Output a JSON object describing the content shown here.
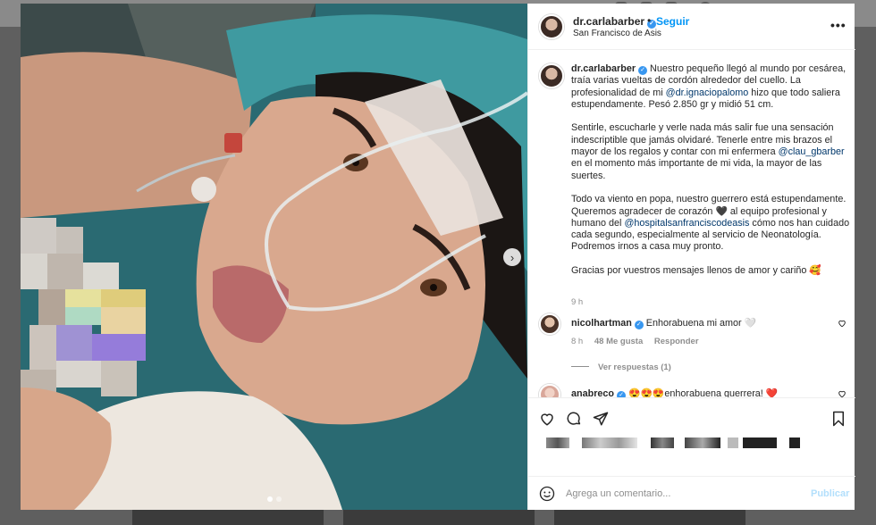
{
  "post": {
    "username": "dr.carlabarber",
    "follow_label": "Seguir",
    "separator": "•",
    "location": "San Francisco de Asis",
    "more_label": "•••",
    "caption_p1_a": " Nuestro pequeño llegó al mundo por cesárea, traía varias vueltas de cordón alrededor del cuello. La profesionalidad de mi ",
    "mention1": "@dr.ignaciopalomo",
    "caption_p1_b": " hizo que todo saliera estupendamente. Pesó 2.850 gr y midió 51 cm.",
    "caption_p2_a": "Sentirle, escucharle y verle nada más salir fue una sensación indescriptible que jamás olvidaré. Tenerle entre mis brazos el mayor de los regalos y contar con mi enfermera ",
    "mention2": "@clau_gbarber",
    "caption_p2_b": " en el momento más importante de mi vida, la mayor de las suertes.",
    "caption_p3_a": "Todo va viento en popa, nuestro guerrero está estupendamente. Queremos agradecer de corazón 🖤 al equipo profesional y humano del ",
    "mention3": "@hospitalsanfrancisco​deasis",
    "caption_p3_b": " cómo nos han cuidado cada segundo, especialmente al servicio de Neonatología. Podremos irnos a casa muy pronto.",
    "caption_p4": "Gracias por vuestros mensajes llenos de amor y cariño 🥰",
    "time_ago": "9 h"
  },
  "comments": [
    {
      "username": "nicolhartman",
      "text": "Enhorabuena mi amor 🤍",
      "time": "8 h",
      "likes": "48 Me gusta",
      "reply_label": "Responder",
      "view_replies": "Ver respuestas (1)"
    },
    {
      "username": "anabreco",
      "text": "😍😍😍enhorabuena guerrera! ❤️"
    }
  ],
  "composer": {
    "placeholder": "Agrega un comentario...",
    "publish_label": "Publicar"
  },
  "icons": {
    "next": "chevron-right-icon",
    "like": "heart-icon",
    "comment": "comment-icon",
    "share": "send-icon",
    "save": "bookmark-icon",
    "emoji": "emoji-icon"
  },
  "colors": {
    "accent": "#0095f6",
    "verified": "#3897f0",
    "link": "#00376b",
    "muted": "#8e8e8e"
  }
}
